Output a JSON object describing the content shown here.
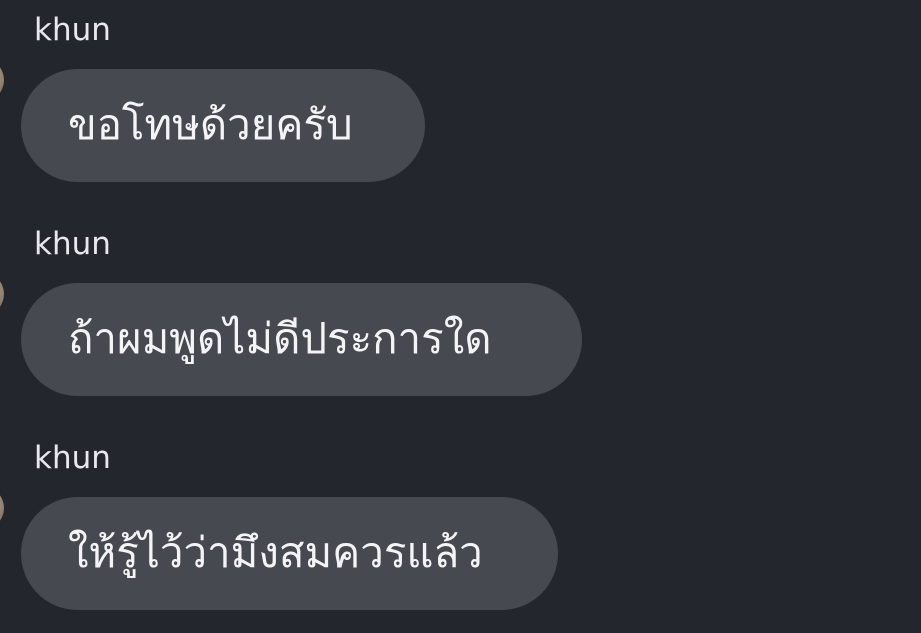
{
  "messages": [
    {
      "sender": "khun",
      "text": "ขอโทษด้วยครับ"
    },
    {
      "sender": "khun",
      "text": "ถ้าผมพูดไม่ดีประการใด"
    },
    {
      "sender": "khun",
      "text": "ให้รู้ไว้ว่ามึงสมควรแล้ว"
    }
  ]
}
